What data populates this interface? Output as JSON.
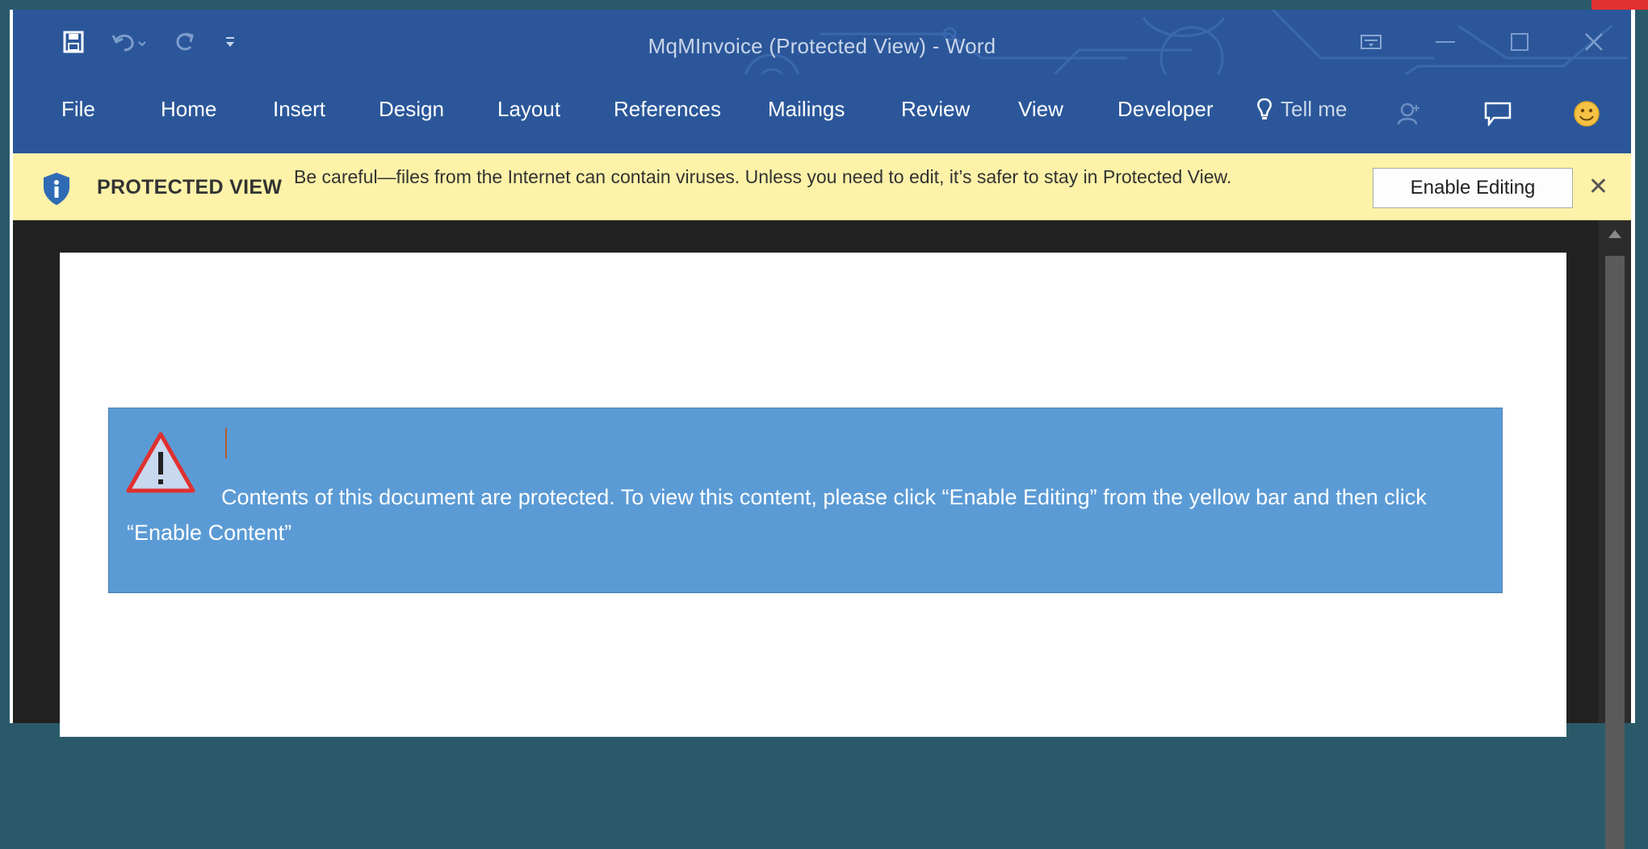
{
  "window": {
    "title": "MqMInvoice (Protected View) - Word"
  },
  "ribbon": {
    "tabs": [
      "File",
      "Home",
      "Insert",
      "Design",
      "Layout",
      "References",
      "Mailings",
      "Review",
      "View",
      "Developer"
    ],
    "tell_me": "Tell me"
  },
  "protected_view": {
    "title": "PROTECTED VIEW",
    "message": "Be careful—files from the Internet can contain viruses. Unless you need to edit, it’s safer to stay in Protected View.",
    "enable_button": "Enable Editing",
    "close": "✕"
  },
  "document": {
    "notice_text": "Contents of this document are protected.  To view this content, please click “Enable Editing” from the yellow bar and then click “Enable Content”"
  },
  "colors": {
    "title_bar": "#2b579a",
    "protected_bar": "#fdf2a8",
    "notice_box": "#5b9bd5",
    "warning_triangle": "#e03030"
  },
  "icons": [
    "save-icon",
    "undo-icon",
    "redo-icon",
    "customize-qat-icon",
    "ribbon-display-icon",
    "minimize-icon",
    "maximize-icon",
    "close-icon",
    "lightbulb-icon",
    "share-user-icon",
    "comments-icon",
    "smiley-icon",
    "shield-info-icon",
    "warning-triangle-icon"
  ]
}
